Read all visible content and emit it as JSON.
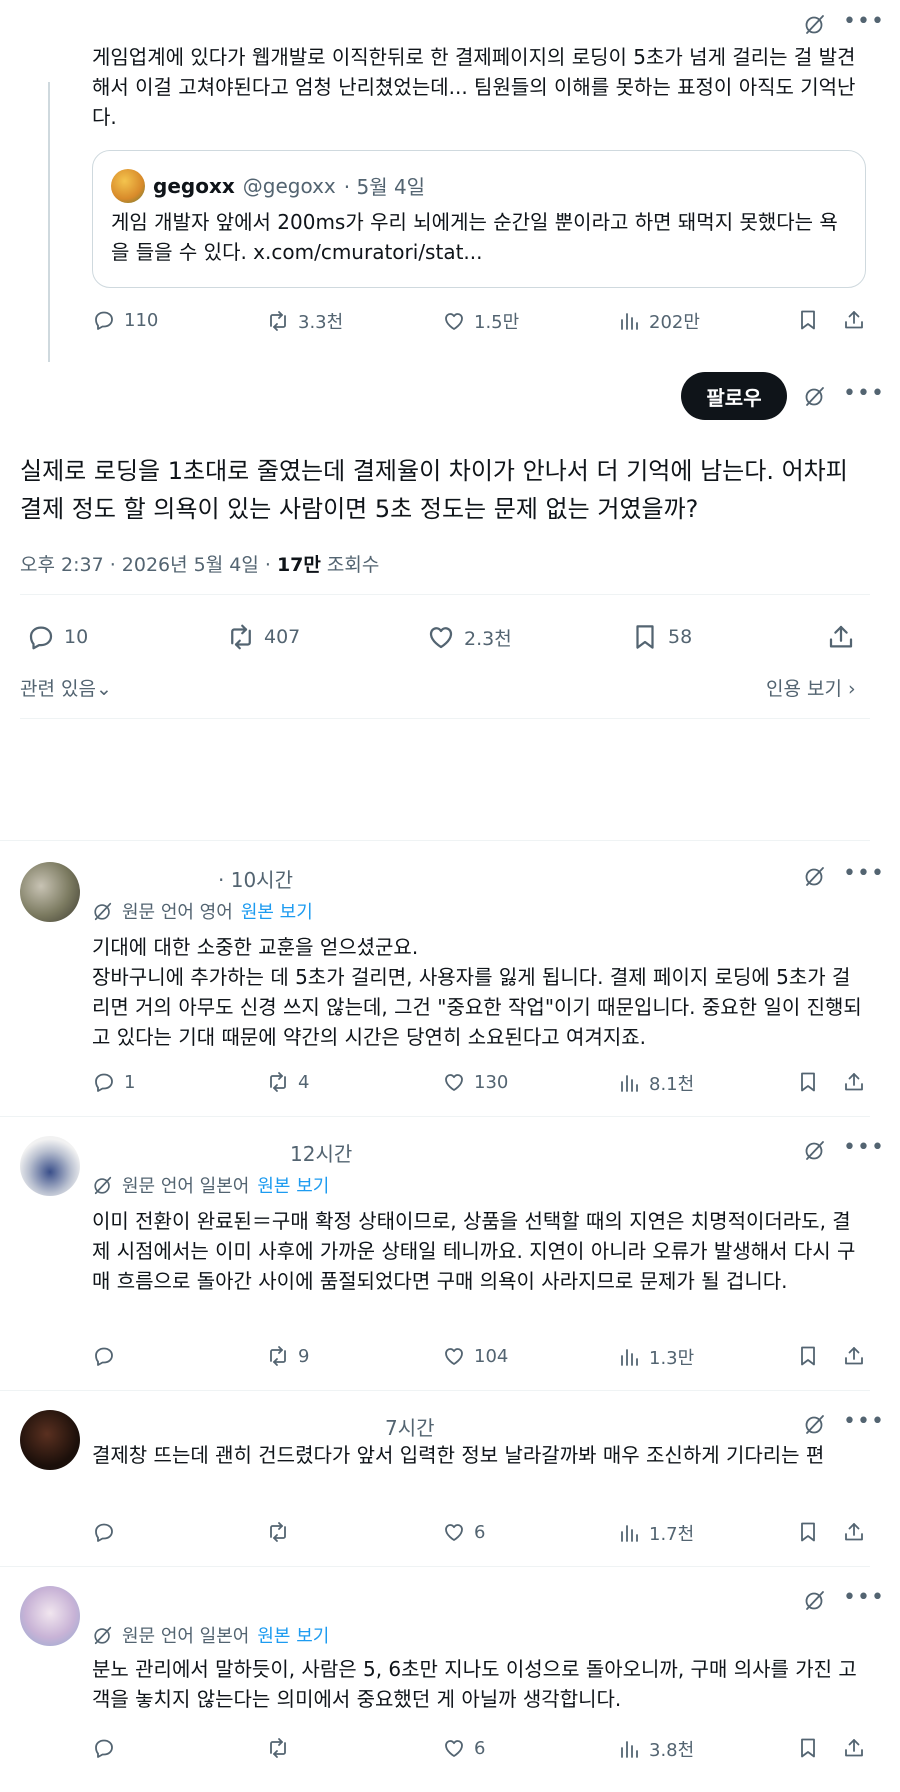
{
  "quoted_thread": {
    "text": "게임업계에 있다가 웹개발로 이직한뒤로 한 결제페이지의 로딩이 5초가 넘게 걸리는 걸 발견해서 이걸 고쳐야된다고 엄청 난리쳤었는데... 팀원들의 이해를 못하는 표정이 아직도 기억난다.",
    "quote": {
      "name": "gegoxx",
      "handle": "@gegoxx",
      "date": "· 5월 4일",
      "text": "게임 개발자 앞에서 200ms가 우리 뇌에게는 순간일 뿐이라고 하면 돼먹지 못했다는 욕을 들을 수 있다. x.com/cmuratori/stat..."
    },
    "actions": {
      "replies": "110",
      "reposts": "3.3천",
      "likes": "1.5만",
      "views": "202만"
    }
  },
  "main_post": {
    "follow_label": "팔로우",
    "text": "실제로 로딩을 1초대로 줄였는데 결제율이 차이가 안나서 더 기억에 남는다. 어차피 결제 정도 할 의욕이 있는 사람이면 5초 정도는 문제 없는 거였을까?",
    "meta_time": "오후 2:37 · 2026년 5월 4일 · ",
    "views_count": "17만",
    "views_label": " 조회수",
    "actions": {
      "replies": "10",
      "reposts": "407",
      "likes": "2.3천",
      "bookmarks": "58"
    },
    "related_label": "관련 있음",
    "quotes_label": "인용 보기"
  },
  "replies": [
    {
      "time": "· 10시간",
      "translation": {
        "label": "원문 언어 영어",
        "link": "원본 보기"
      },
      "text": "기대에 대한 소중한 교훈을 얻으셨군요.\n장바구니에 추가하는 데 5초가 걸리면, 사용자를 잃게 됩니다. 결제 페이지 로딩에 5초가 걸리면 거의 아무도 신경 쓰지 않는데, 그건 \"중요한 작업\"이기 때문입니다. 중요한 일이 진행되고 있다는 기대 때문에 약간의 시간은 당연히 소요된다고 여겨지죠.",
      "actions": {
        "replies": "1",
        "reposts": "4",
        "likes": "130",
        "views": "8.1천"
      }
    },
    {
      "time": "12시간",
      "translation": {
        "label": "원문 언어 일본어",
        "link": "원본 보기"
      },
      "text": "이미 전환이 완료된＝구매 확정 상태이므로, 상품을 선택할 때의 지연은 치명적이더라도, 결제 시점에서는 이미 사후에 가까운 상태일 테니까요. 지연이 아니라 오류가 발생해서 다시 구매 흐름으로 돌아간 사이에 품절되었다면 구매 의욕이 사라지므로 문제가 될 겁니다.",
      "actions": {
        "replies": "",
        "reposts": "9",
        "likes": "104",
        "views": "1.3만"
      }
    },
    {
      "time": "7시간",
      "text": "결제창 뜨는데 괜히 건드렸다가 앞서 입력한 정보 날라갈까봐 매우 조신하게 기다리는 편",
      "actions": {
        "replies": "",
        "reposts": "",
        "likes": "6",
        "views": "1.7천"
      }
    },
    {
      "translation": {
        "label": "원문 언어 일본어",
        "link": "원본 보기"
      },
      "text": "분노 관리에서 말하듯이, 사람은 5, 6초만 지나도 이성으로 돌아오니까, 구매 의사를 가진 고객을 놓치지 않는다는 의미에서 중요했던 게 아닐까 생각합니다.",
      "actions": {
        "replies": "",
        "reposts": "",
        "likes": "6",
        "views": "3.8천"
      }
    }
  ],
  "colors": {
    "text": "#0f1419",
    "muted": "#536471",
    "link": "#1d9bf0",
    "border": "#eff3f4",
    "follow_bg": "#0f1419"
  }
}
